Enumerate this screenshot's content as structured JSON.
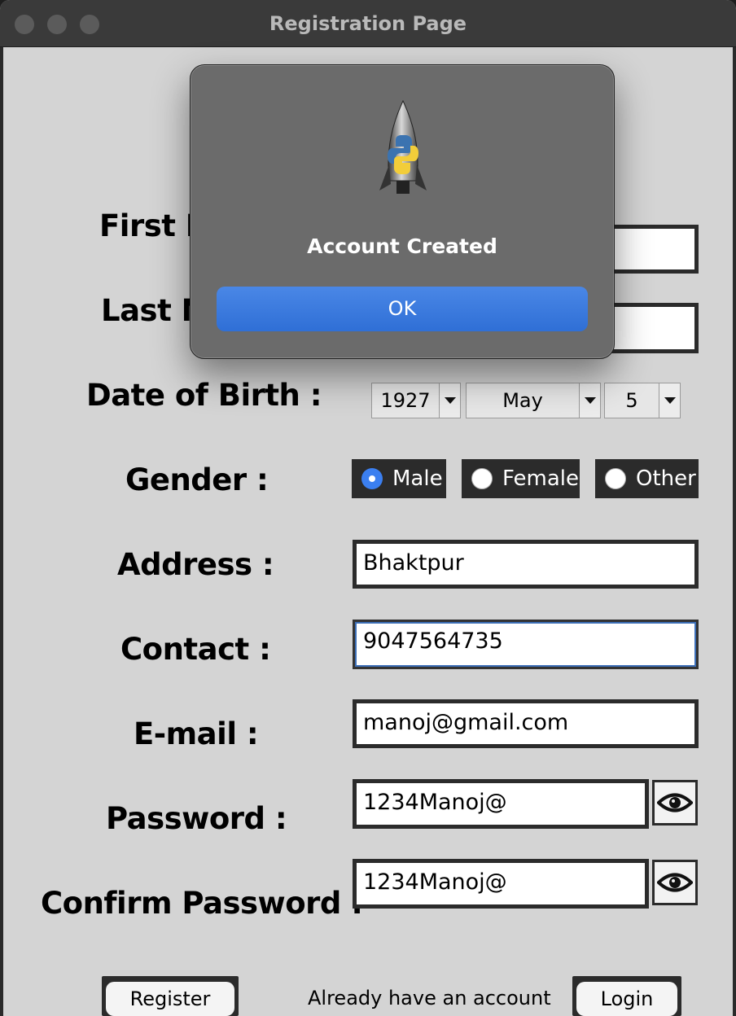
{
  "window": {
    "title": "Registration Page"
  },
  "form": {
    "first_name_label": "First N",
    "last_name_label": "Last N",
    "dob_label": "Date of Birth :",
    "dob": {
      "year": "1927",
      "month": "May",
      "day": "5"
    },
    "gender_label": "Gender :",
    "gender_options": [
      "Male",
      "Female",
      "Other"
    ],
    "gender_selected": "Male",
    "address_label": "Address :",
    "address_value": "Bhaktpur",
    "contact_label": "Contact :",
    "contact_value": "9047564735",
    "email_label": "E-mail :",
    "email_value": "manoj@gmail.com",
    "password_label": "Password :",
    "password_value": "1234Manoj@",
    "confirm_password_label": "Confirm Password :",
    "confirm_password_value": "1234Manoj@"
  },
  "footer": {
    "register_label": "Register",
    "prompt_text": "Already have an account",
    "login_label": "Login"
  },
  "dialog": {
    "message": "Account Created",
    "ok_label": "OK",
    "icon": "python-launcher-rocket-icon"
  },
  "colors": {
    "accent": "#3b7ff0",
    "ok_button": "#3a77dd",
    "field_border": "#2b2b2b",
    "window_bg": "#d4d4d4"
  },
  "icons": {
    "show_password": "eye-icon"
  }
}
